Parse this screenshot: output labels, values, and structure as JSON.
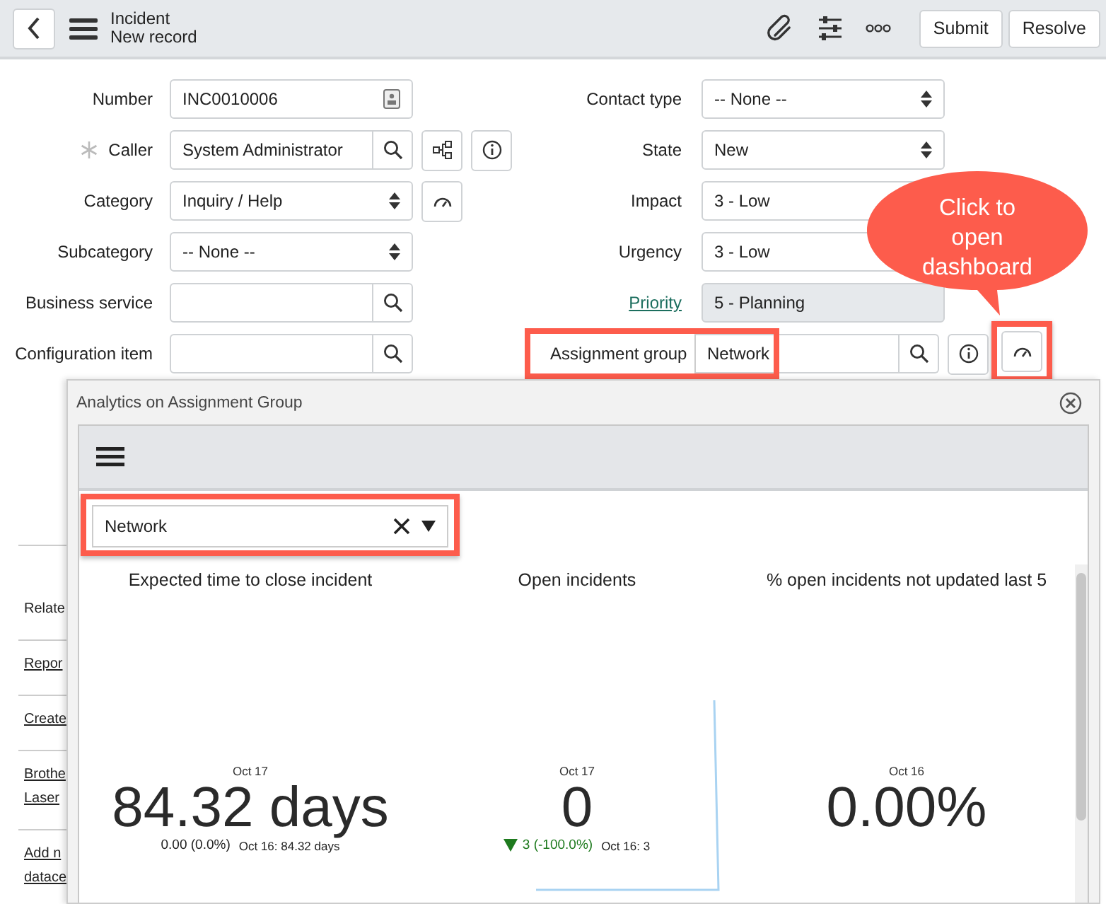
{
  "header": {
    "title": "Incident",
    "subtitle": "New record",
    "buttons": [
      "Submit",
      "Resolve"
    ]
  },
  "form": {
    "left": [
      {
        "label": "Number",
        "value": "INC0010006",
        "kind": "text",
        "required": false,
        "link": false,
        "highlighted": false
      },
      {
        "label": "Caller",
        "value": "System Administrator",
        "kind": "lookup",
        "required": true,
        "link": false,
        "highlighted": false,
        "actions": [
          {
            "kind": "hierarchy",
            "highlighted": false
          },
          {
            "kind": "info",
            "highlighted": false
          }
        ]
      },
      {
        "label": "Category",
        "value": "Inquiry / Help",
        "kind": "select",
        "required": false,
        "link": false,
        "highlighted": false,
        "actions": [
          {
            "kind": "dashboard",
            "highlighted": false
          }
        ]
      },
      {
        "label": "Subcategory",
        "value": "-- None --",
        "kind": "select",
        "required": false,
        "link": false,
        "highlighted": false
      },
      {
        "label": "Business service",
        "kind": "lookup",
        "required": false,
        "link": false,
        "highlighted": false
      },
      {
        "label": "Configuration item",
        "kind": "lookup",
        "required": false,
        "link": false,
        "highlighted": false
      }
    ],
    "right": [
      {
        "label": "Contact type",
        "value": "-- None --",
        "kind": "select",
        "required": false,
        "link": false,
        "highlighted": false
      },
      {
        "label": "State",
        "value": "New",
        "kind": "select",
        "required": false,
        "link": false,
        "highlighted": false
      },
      {
        "label": "Impact",
        "value": "3 - Low",
        "kind": "covered-select",
        "required": false,
        "link": false,
        "highlighted": false
      },
      {
        "label": "Urgency",
        "value": "3 - Low",
        "kind": "covered-select",
        "required": false,
        "link": false,
        "highlighted": false
      },
      {
        "label": "Priority",
        "value": "5 - Planning",
        "kind": "readonly",
        "required": false,
        "link": true,
        "highlighted": false
      },
      {
        "label": "Assignment group",
        "value": "Network",
        "kind": "lookup",
        "required": false,
        "link": false,
        "highlighted": true,
        "actions": [
          {
            "kind": "info",
            "highlighted": false
          },
          {
            "kind": "dashboard",
            "highlighted": true
          }
        ]
      }
    ]
  },
  "related": [
    {
      "label": "Relate",
      "link": false
    },
    {
      "label": "Repor",
      "link": true
    },
    {
      "label": "Create",
      "link": true
    },
    {
      "label": "Brothe\nLaser",
      "link": true
    },
    {
      "label": "Add n\ndatace",
      "link": true
    }
  ],
  "callout": {
    "text": "Click to open dashboard"
  },
  "analytics": {
    "title": "Analytics on Assignment Group",
    "filter": {
      "value": "Network",
      "highlighted": true
    },
    "widgets": [
      {
        "title": "Expected time to close incident",
        "date": "Oct 17",
        "value": "84.32 days",
        "change": "0.00 (0.0%)",
        "falling": false,
        "previous": "Oct 16: 84.32 days",
        "kind": "plain"
      },
      {
        "title": "Open incidents",
        "date": "Oct 17",
        "value": "0",
        "change": "3 (-100.0%)",
        "falling": true,
        "previous": "Oct 16: 3",
        "kind": "sparkline"
      },
      {
        "title": "% open incidents not updated last 5",
        "date": "Oct 16",
        "value": "0.00%",
        "kind": "plain"
      }
    ]
  }
}
